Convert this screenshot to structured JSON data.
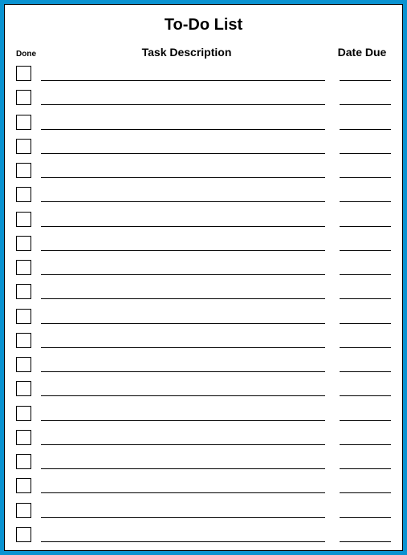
{
  "title": "To-Do List",
  "columns": {
    "done": "Done",
    "task": "Task Description",
    "date": "Date Due"
  },
  "rows": [
    {
      "done": false,
      "task": "",
      "date": ""
    },
    {
      "done": false,
      "task": "",
      "date": ""
    },
    {
      "done": false,
      "task": "",
      "date": ""
    },
    {
      "done": false,
      "task": "",
      "date": ""
    },
    {
      "done": false,
      "task": "",
      "date": ""
    },
    {
      "done": false,
      "task": "",
      "date": ""
    },
    {
      "done": false,
      "task": "",
      "date": ""
    },
    {
      "done": false,
      "task": "",
      "date": ""
    },
    {
      "done": false,
      "task": "",
      "date": ""
    },
    {
      "done": false,
      "task": "",
      "date": ""
    },
    {
      "done": false,
      "task": "",
      "date": ""
    },
    {
      "done": false,
      "task": "",
      "date": ""
    },
    {
      "done": false,
      "task": "",
      "date": ""
    },
    {
      "done": false,
      "task": "",
      "date": ""
    },
    {
      "done": false,
      "task": "",
      "date": ""
    },
    {
      "done": false,
      "task": "",
      "date": ""
    },
    {
      "done": false,
      "task": "",
      "date": ""
    },
    {
      "done": false,
      "task": "",
      "date": ""
    },
    {
      "done": false,
      "task": "",
      "date": ""
    },
    {
      "done": false,
      "task": "",
      "date": ""
    }
  ]
}
